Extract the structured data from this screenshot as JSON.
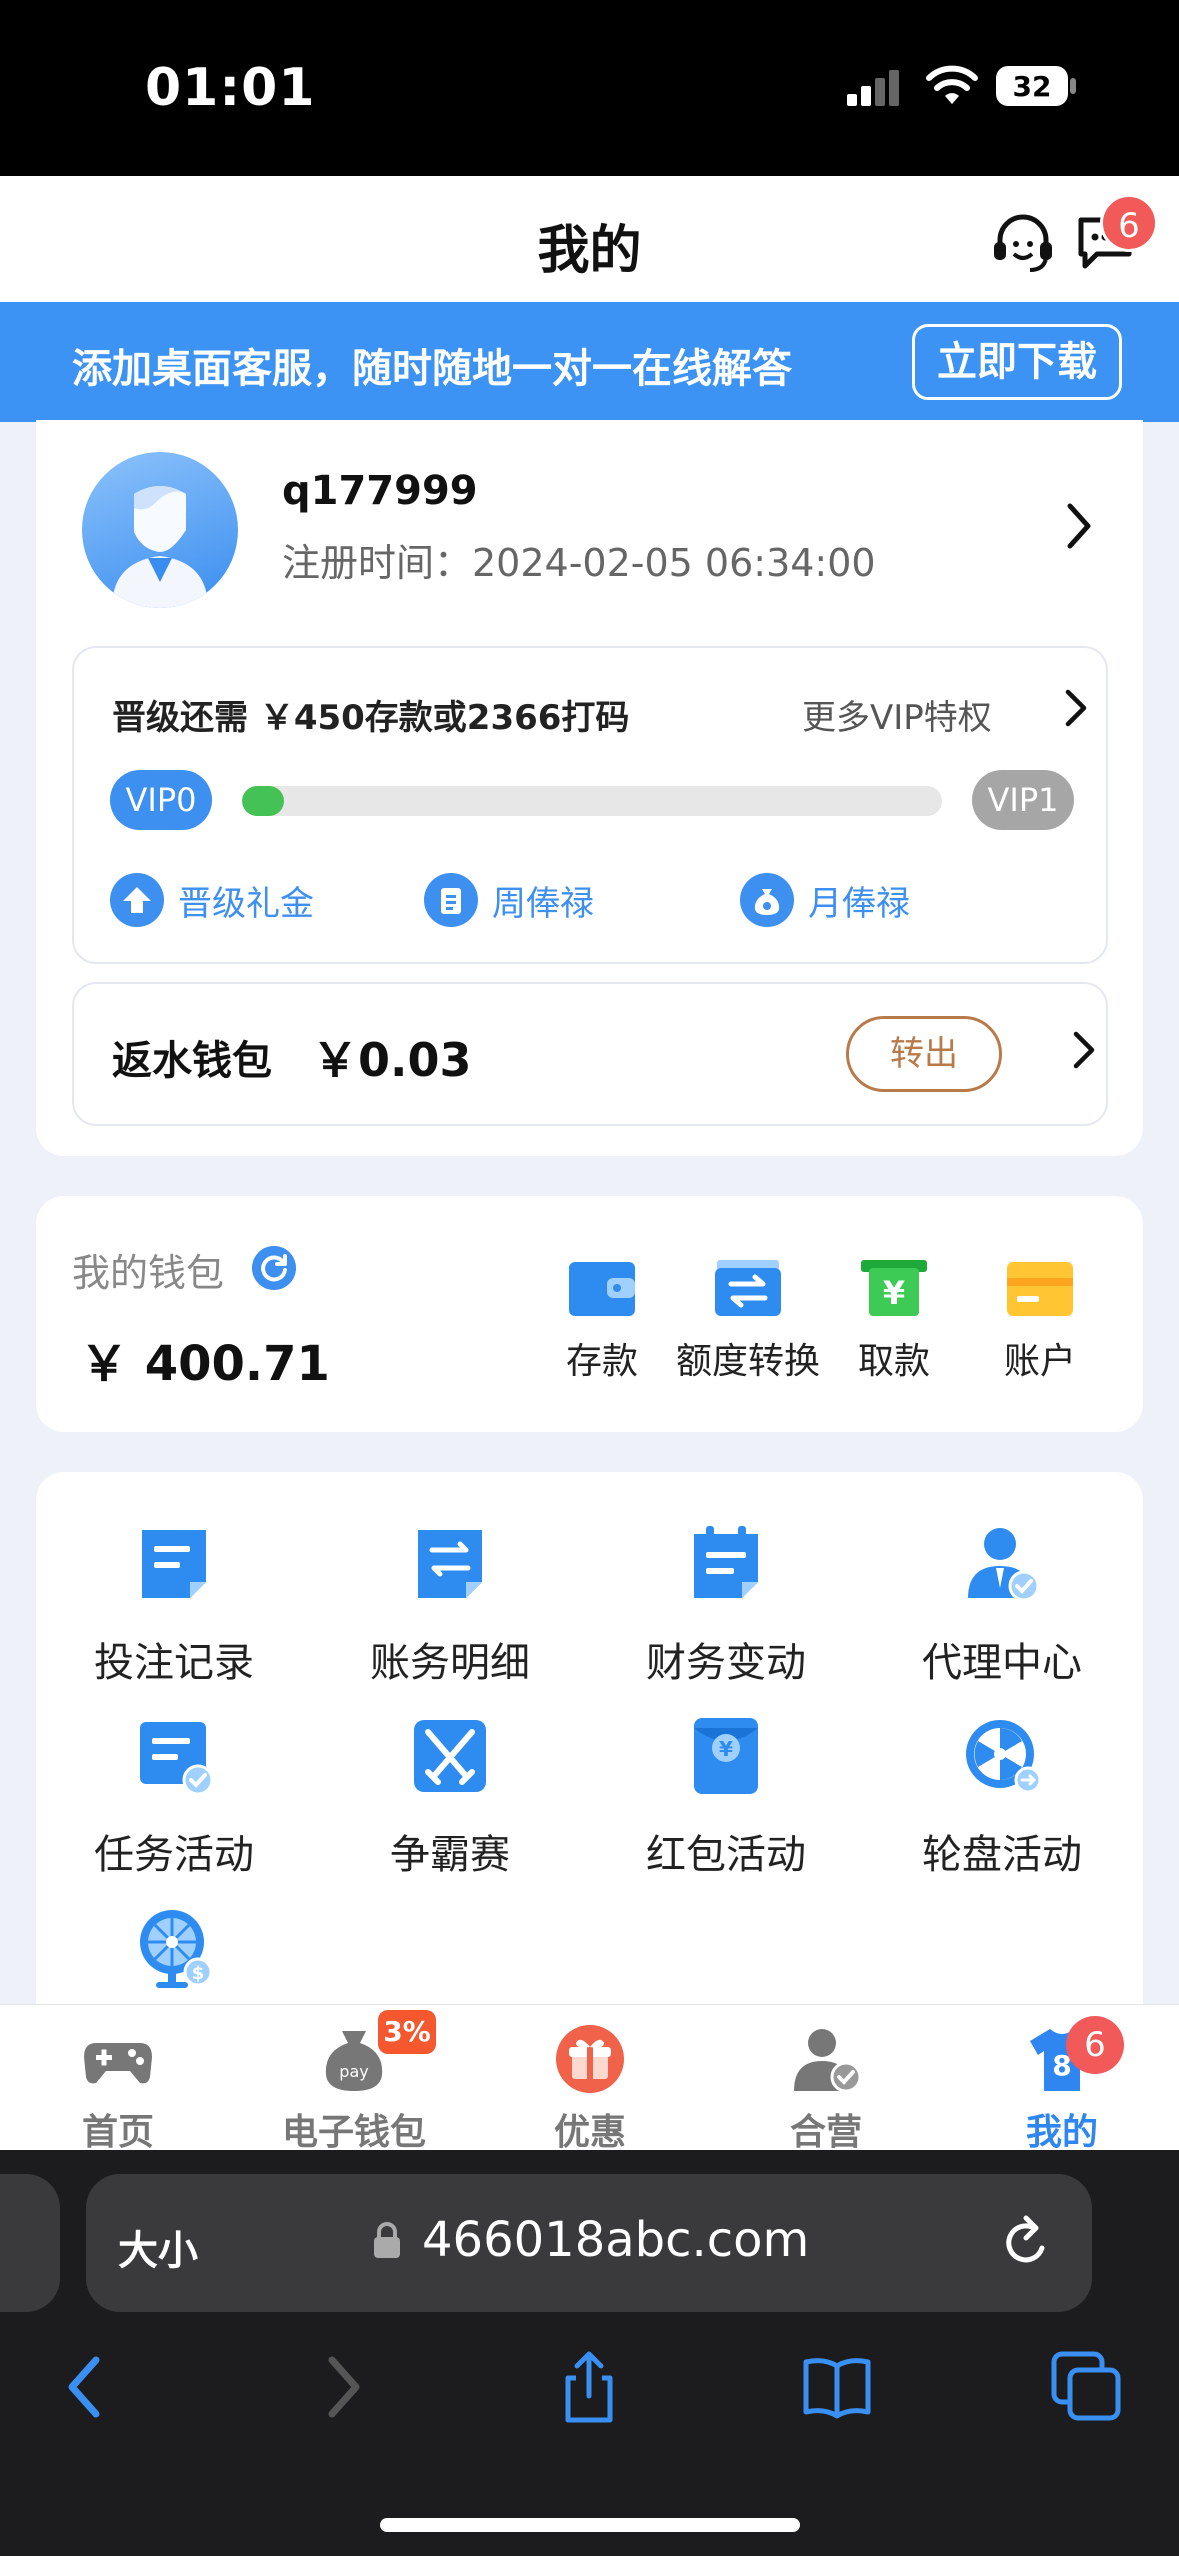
{
  "status_bar": {
    "time": "01:01",
    "battery": "32"
  },
  "header": {
    "title": "我的",
    "message_count": "6"
  },
  "banner": {
    "text": "添加桌面客服，随时随地一对一在线解答",
    "button": "立即下载"
  },
  "profile": {
    "username": "q177999",
    "register_time": "注册时间：2024-02-05 06:34:00",
    "vip": {
      "upgrade_need": "晋级还需 ￥450存款或2366打码",
      "more_label": "更多VIP特权",
      "current_level": "VIP0",
      "next_level": "VIP1",
      "progress_fraction": 0.06,
      "perks": [
        {
          "label": "晋级礼金",
          "icon": "upgrade-icon"
        },
        {
          "label": "周俸禄",
          "icon": "clipboard-icon"
        },
        {
          "label": "月俸禄",
          "icon": "money-bag-icon"
        }
      ]
    },
    "rebate": {
      "label": "返水钱包",
      "amount": "￥0.03",
      "button": "转出"
    }
  },
  "wallet": {
    "label": "我的钱包",
    "amount": "￥ 400.71",
    "actions": [
      {
        "label": "存款",
        "icon": "wallet-icon"
      },
      {
        "label": "额度转换",
        "icon": "transfer-icon"
      },
      {
        "label": "取款",
        "icon": "withdraw-icon"
      },
      {
        "label": "账户",
        "icon": "card-icon"
      }
    ]
  },
  "menu": {
    "items": [
      {
        "label": "投注记录",
        "icon": "bet-record-icon"
      },
      {
        "label": "账务明细",
        "icon": "account-detail-icon"
      },
      {
        "label": "财务变动",
        "icon": "finance-change-icon"
      },
      {
        "label": "代理中心",
        "icon": "agent-icon"
      },
      {
        "label": "任务活动",
        "icon": "task-icon"
      },
      {
        "label": "争霸赛",
        "icon": "swords-icon"
      },
      {
        "label": "红包活动",
        "icon": "red-packet-icon"
      },
      {
        "label": "轮盘活动",
        "icon": "roulette-icon"
      },
      {
        "label": "",
        "icon": "wheel-icon"
      }
    ]
  },
  "tabbar": {
    "tabs": [
      {
        "label": "首页",
        "icon": "gamepad-icon"
      },
      {
        "label": "电子钱包",
        "icon": "pay-bag-icon"
      },
      {
        "label": "优惠",
        "icon": "gift-icon"
      },
      {
        "label": "合营",
        "icon": "partner-icon"
      },
      {
        "label": "我的",
        "icon": "jersey-icon"
      }
    ],
    "promo_badge": "3%",
    "mine_badge": "6",
    "mine_jersey_number": "8"
  },
  "browser": {
    "size_label": "大小",
    "url": "466018abc.com"
  },
  "colors": {
    "accent": "#3d93f4",
    "progress": "#45c256",
    "badge": "#f25a5a",
    "rebate_button": "#b97a4a"
  }
}
